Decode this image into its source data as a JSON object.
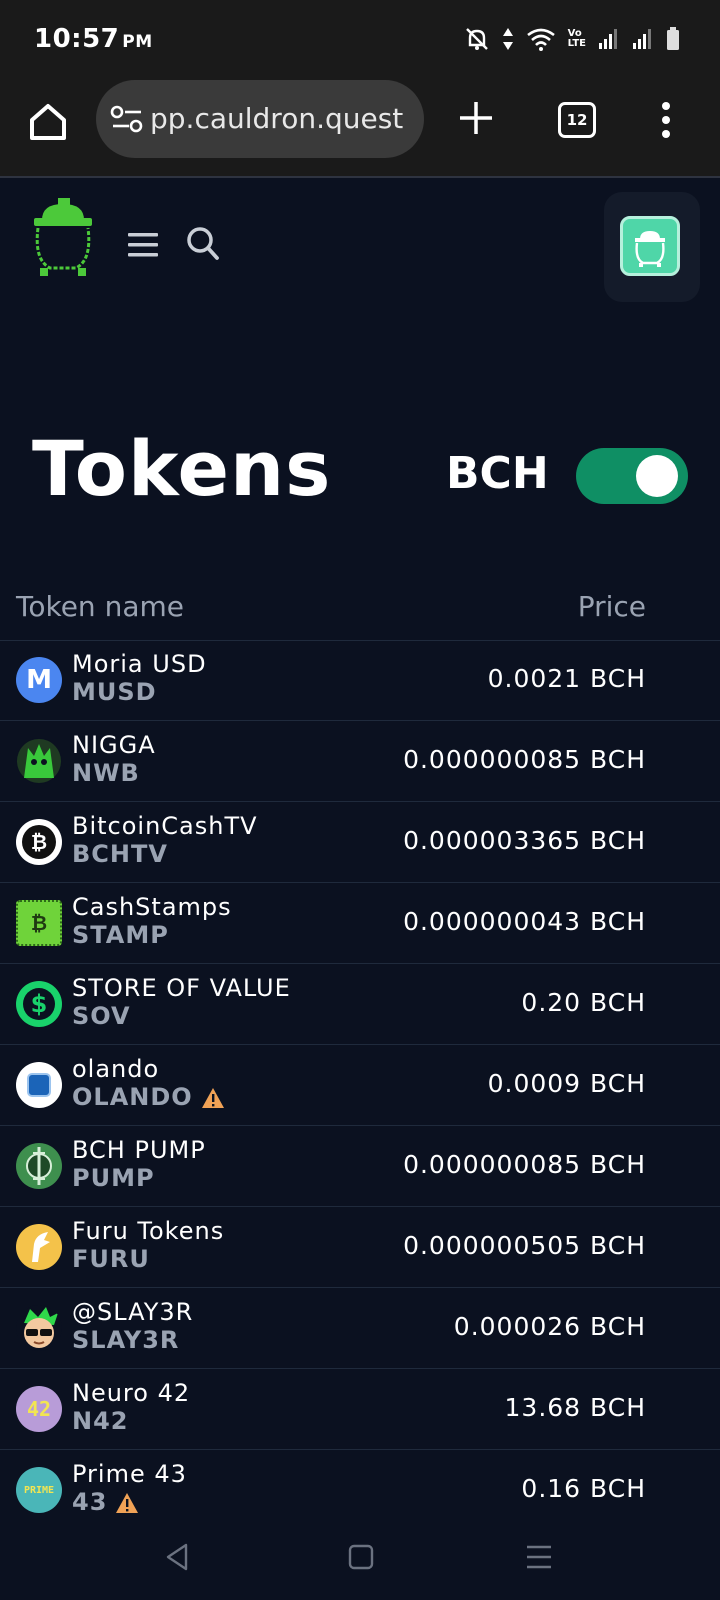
{
  "status_bar": {
    "time": "10:57",
    "ampm": "PM",
    "icons": [
      "mute-bell-icon",
      "data-arrows-icon",
      "wifi-icon",
      "volte-icon",
      "signal-icon",
      "signal-icon",
      "battery-icon"
    ],
    "volte_text": "Vo\nLTE"
  },
  "browser": {
    "url": "pp.cauldron.quest",
    "tab_count": "12"
  },
  "header": {
    "logo_icon": "cauldron-logo-icon",
    "account_icon": "cauldron-avatar-icon"
  },
  "page": {
    "title": "Tokens",
    "currency": "BCH",
    "toggle_on": true
  },
  "table": {
    "headers": {
      "name": "Token name",
      "price": "Price"
    },
    "rows": [
      {
        "name": "Moria USD",
        "symbol": "MUSD",
        "price": "0.0021 BCH",
        "warning": false,
        "icon": "moria-icon",
        "icon_color": "#4b86f0"
      },
      {
        "name": "NIGGA",
        "symbol": "NWB",
        "price": "0.000000085 BCH",
        "warning": false,
        "icon": "nwb-icon",
        "icon_color": "#39c93b"
      },
      {
        "name": "BitcoinCashTV",
        "symbol": "BCHTV",
        "price": "0.000003365 BCH",
        "warning": false,
        "icon": "bchtv-icon",
        "icon_color": "#ffffff"
      },
      {
        "name": "CashStamps",
        "symbol": "STAMP",
        "price": "0.000000043 BCH",
        "warning": false,
        "icon": "stamp-icon",
        "icon_color": "#6fd33a"
      },
      {
        "name": "STORE OF VALUE",
        "symbol": "SOV",
        "price": "0.20 BCH",
        "warning": false,
        "icon": "dollar-icon",
        "icon_color": "#19d26b"
      },
      {
        "name": "olando",
        "symbol": "OLANDO",
        "price": "0.0009 BCH",
        "warning": true,
        "icon": "olando-icon",
        "icon_color": "#ffffff"
      },
      {
        "name": "BCH PUMP",
        "symbol": "PUMP",
        "price": "0.000000085 BCH",
        "warning": false,
        "icon": "pump-icon",
        "icon_color": "#3e8f4e"
      },
      {
        "name": "Furu Tokens",
        "symbol": "FURU",
        "price": "0.000000505 BCH",
        "warning": false,
        "icon": "furu-icon",
        "icon_color": "#f4c24a"
      },
      {
        "name": "@SLAY3R",
        "symbol": "SLAY3R",
        "price": "0.000026 BCH",
        "warning": false,
        "icon": "slay3r-icon",
        "icon_color": "#0b1120"
      },
      {
        "name": "Neuro 42",
        "symbol": "N42",
        "price": "13.68 BCH",
        "warning": false,
        "icon": "n42-icon",
        "icon_color": "#b89cd8"
      },
      {
        "name": "Prime 43",
        "symbol": "43",
        "price": "0.16 BCH",
        "warning": true,
        "icon": "prime43-icon",
        "icon_color": "#4ab6b8"
      }
    ]
  },
  "icon_text": {
    "moria": "M",
    "bchtv": "₿",
    "stamp": "₿",
    "dollar": "$",
    "n42": "42",
    "prime43": "PRIME"
  },
  "colors": {
    "background": "#0b1120",
    "toggle_on": "#0f8f64",
    "muted_text": "#9aa3b2",
    "warning": "#f0a256"
  }
}
